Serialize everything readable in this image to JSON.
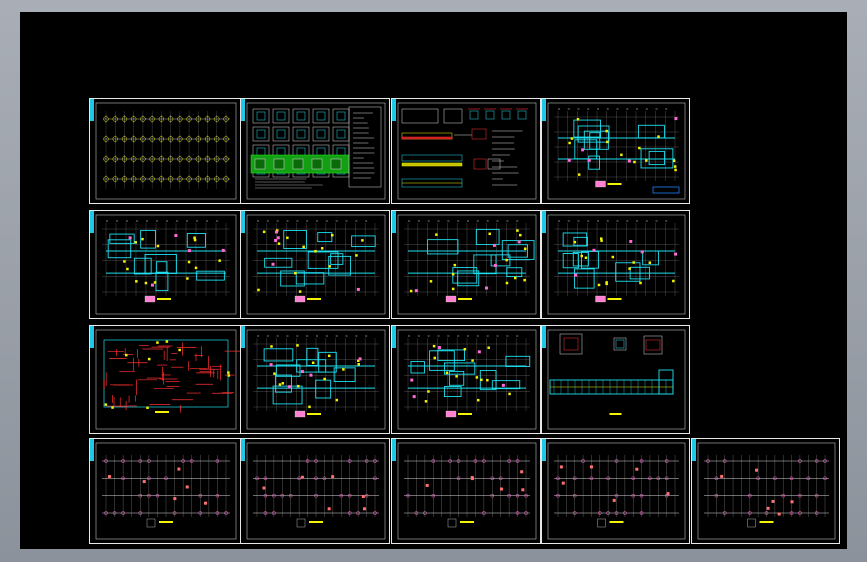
{
  "viewer": {
    "background_color": "#000000",
    "frame_color": "#9aa0a9",
    "accent_tab_color": "#20c8e8"
  },
  "sheets": [
    {
      "id": "s1",
      "kind": "column-grid",
      "row": 1
    },
    {
      "id": "s2",
      "kind": "detail-table",
      "row": 1
    },
    {
      "id": "s3",
      "kind": "beam-details",
      "row": 1
    },
    {
      "id": "s4",
      "kind": "floor-plan",
      "row": 1
    },
    {
      "id": "s5",
      "kind": "floor-plan-long",
      "row": 2
    },
    {
      "id": "s6",
      "kind": "floor-plan",
      "row": 2
    },
    {
      "id": "s7",
      "kind": "floor-plan",
      "row": 2
    },
    {
      "id": "s8",
      "kind": "floor-plan",
      "row": 2
    },
    {
      "id": "s9",
      "kind": "rebar-plan-red",
      "row": 3
    },
    {
      "id": "s10",
      "kind": "floor-plan",
      "row": 3
    },
    {
      "id": "s11",
      "kind": "floor-plan",
      "row": 3
    },
    {
      "id": "s12",
      "kind": "section-details",
      "row": 3
    },
    {
      "id": "s13",
      "kind": "foundation-grid",
      "row": 4
    },
    {
      "id": "s14",
      "kind": "foundation-grid",
      "row": 4
    },
    {
      "id": "s15",
      "kind": "foundation-grid",
      "row": 4
    },
    {
      "id": "s16",
      "kind": "foundation-grid",
      "row": 4
    },
    {
      "id": "s17",
      "kind": "foundation-grid",
      "row": 4
    }
  ]
}
